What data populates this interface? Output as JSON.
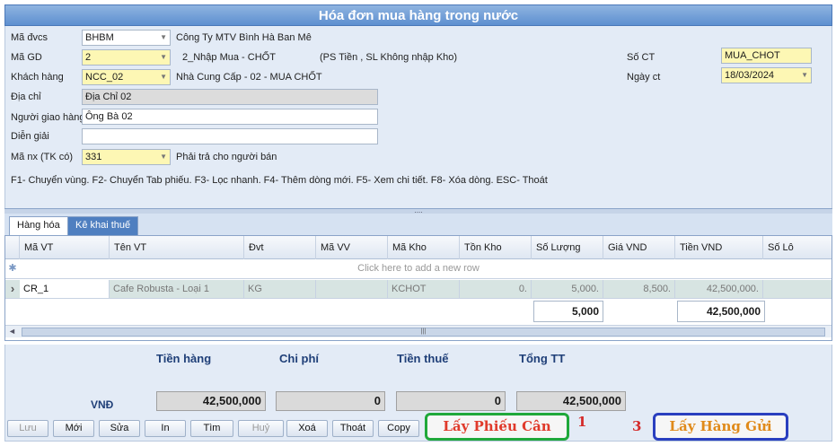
{
  "window": {
    "title": "Hóa đơn mua hàng trong nước"
  },
  "form": {
    "ma_dvcs": {
      "label": "Mã đvcs",
      "value": "BHBM",
      "desc": "Công Ty MTV Bình Hà Ban Mê"
    },
    "ma_gd": {
      "label": "Mã GD",
      "value": "2",
      "desc": "2_Nhập Mua - CHỐT",
      "note": "(PS Tiền ,  SL Không nhập Kho)"
    },
    "khach_hang": {
      "label": "Khách hàng",
      "value": "NCC_02",
      "desc": "Nhà Cung Cấp - 02 - MUA CHỐT"
    },
    "dia_chi": {
      "label": "Địa chỉ",
      "value": "Địa Chỉ 02"
    },
    "nguoi_giao_hang": {
      "label": "Người giao hàng",
      "value": "Ông Bà 02"
    },
    "dien_giai": {
      "label": "Diễn giải",
      "value": ""
    },
    "ma_nx": {
      "label": "Mã nx (TK có)",
      "value": "331",
      "desc": "Phải trả cho người bán"
    },
    "so_ct": {
      "label": "Số CT",
      "value": "MUA_CHOT"
    },
    "ngay_ct": {
      "label": "Ngày ct",
      "value": "18/03/2024"
    },
    "shortcuts": "F1- Chuyển vùng. F2- Chuyển Tab phiếu. F3- Lọc nhanh. F4- Thêm dòng mới. F5- Xem chi tiết. F8- Xóa dòng. ESC- Thoát"
  },
  "splitter": "....",
  "tabs": [
    "Hàng hóa",
    "Kê khai thuế"
  ],
  "grid": {
    "columns": [
      "Mã VT",
      "Tên VT",
      "Đvt",
      "Mã VV",
      "Mã Kho",
      "Tồn Kho",
      "Số Lượng",
      "Giá VND",
      "Tiền VND",
      "Số Lô"
    ],
    "add_row_text": "Click here to add a new row",
    "add_indicator": "✱",
    "row_indicator": "›",
    "rows": [
      {
        "ma_vt": "CR_1",
        "ten_vt": "Cafe Robusta - Loại 1",
        "dvt": "KG",
        "ma_vv": "",
        "ma_kho": "KCHOT",
        "ton_kho": "0.",
        "so_luong": "5,000.",
        "gia": "8,500.",
        "tien": "42,500,000.",
        "so_lo": ""
      }
    ],
    "total_so_luong": "5,000",
    "total_tien": "42,500,000",
    "scroll_left": "◄",
    "scroll_thumb": "|||"
  },
  "totals": {
    "tien_hang_label": "Tiền hàng",
    "chi_phi_label": "Chi phí",
    "tien_thue_label": "Tiền thuế",
    "tong_tt_label": "Tổng TT",
    "currency": "VNĐ",
    "tien_hang": "42,500,000",
    "chi_phi": "0",
    "tien_thue": "0",
    "tong_tt": "42,500,000"
  },
  "buttons": {
    "luu": "Lưu",
    "moi": "Mới",
    "sua": "Sửa",
    "in": "In",
    "tim": "Tìm",
    "huy": "Huỷ",
    "xoa": "Xoá",
    "thoat": "Thoát",
    "copy": "Copy",
    "lay_phieu_can": "Lấy Phiếu Cân",
    "lay_hang_gui": "Lấy Hàng Gửi"
  },
  "annotations": {
    "n1": "1",
    "n3": "3"
  }
}
